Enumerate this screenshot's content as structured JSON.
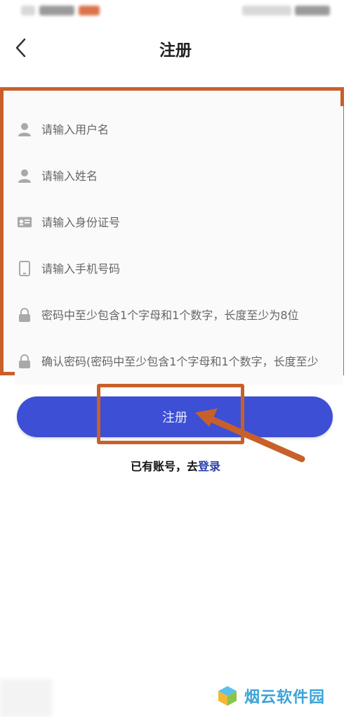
{
  "header": {
    "title": "注册",
    "back_icon": "chevron-left-icon"
  },
  "form": {
    "fields": [
      {
        "placeholder": "请输入用户名",
        "icon": "person-icon"
      },
      {
        "placeholder": "请输入姓名",
        "icon": "person-icon"
      },
      {
        "placeholder": "请输入身份证号",
        "icon": "id-card-icon"
      },
      {
        "placeholder": "请输入手机号码",
        "icon": "phone-icon"
      },
      {
        "placeholder": "密码中至少包含1个字母和1个数字，长度至少为8位",
        "icon": "lock-icon"
      },
      {
        "placeholder": "确认密码(密码中至少包含1个字母和1个数字，长度至少",
        "icon": "lock-icon"
      }
    ]
  },
  "register_button": {
    "label": "注册"
  },
  "login_prompt": {
    "text": "已有账号，去",
    "link": "登录"
  },
  "watermark": {
    "text": "烟云软件园"
  },
  "colors": {
    "accent": "#3d4fd4",
    "annotation": "#c8602a",
    "link": "#2a3fa8",
    "watermark": "#3aa4d9"
  }
}
